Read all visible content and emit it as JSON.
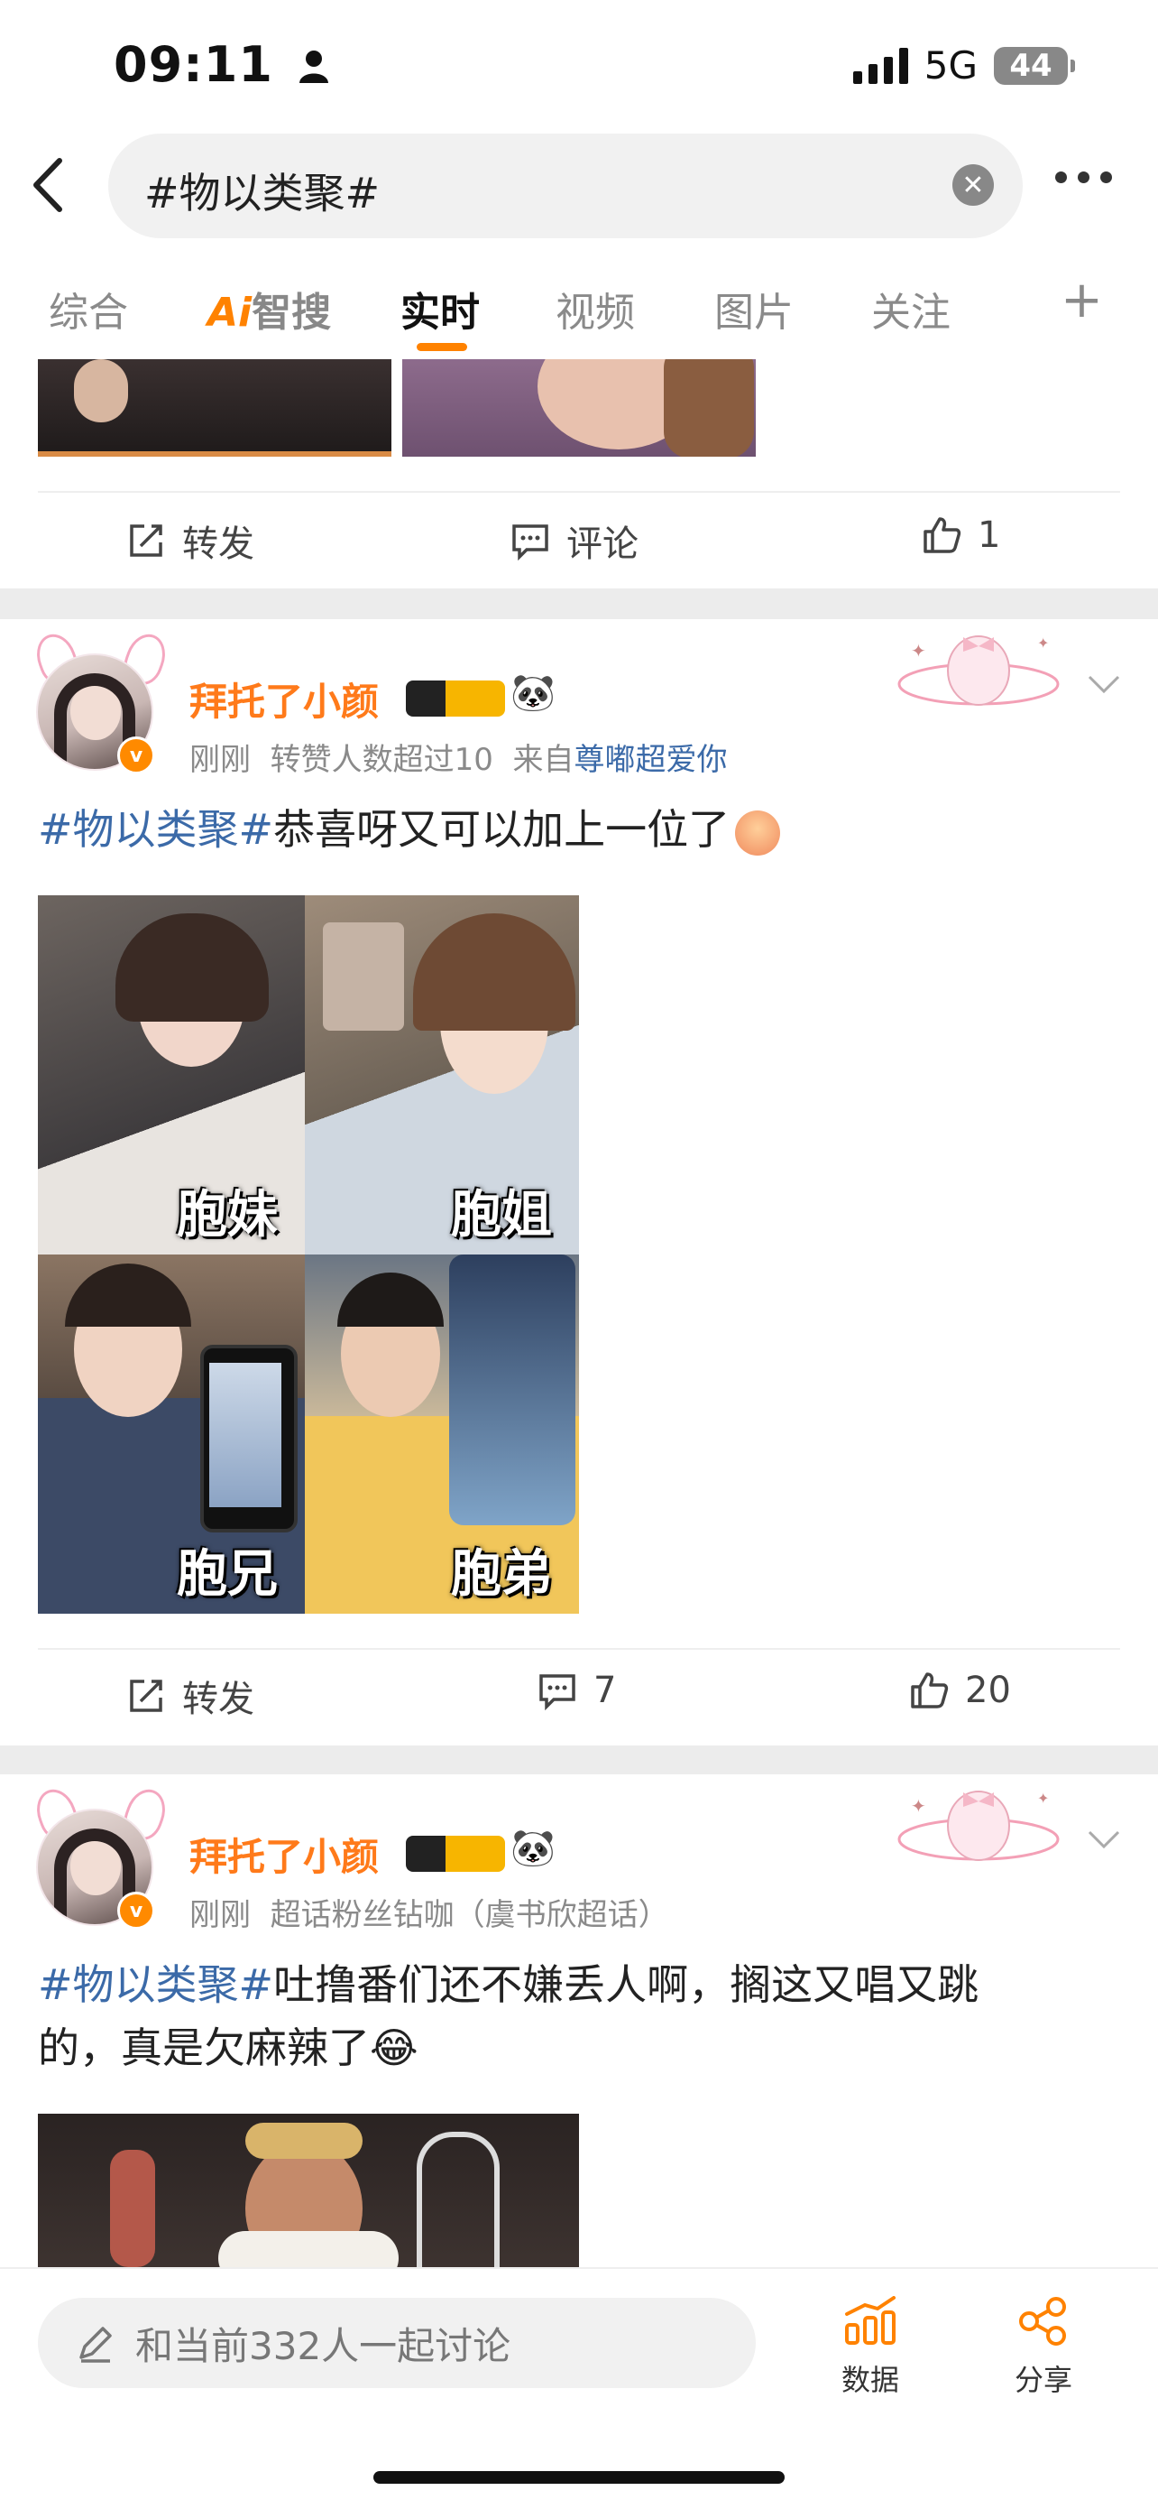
{
  "status_bar": {
    "time": "09:11",
    "network": "5G",
    "battery": "44"
  },
  "search": {
    "query": "#物以类聚#"
  },
  "tabs": [
    {
      "label": "综合"
    },
    {
      "label_ai": "Ai",
      "label_rest": "智搜"
    },
    {
      "label": "实时"
    },
    {
      "label": "视频"
    },
    {
      "label": "图片"
    },
    {
      "label": "关注"
    }
  ],
  "tab_add_symbol": "+",
  "post0": {
    "repost_label": "转发",
    "comment_label": "评论",
    "like_count": "1"
  },
  "post1": {
    "username": "拜托了小颜",
    "meta_time": "刚刚",
    "meta_info": "转赞人数超过10",
    "meta_from_prefix": "来自",
    "meta_from": "尊嘟超爱你",
    "hashtag": "#物以类聚#",
    "text": "恭喜呀又可以加上一位了",
    "images": [
      {
        "label": "胞妹"
      },
      {
        "label": "胞姐"
      },
      {
        "label": "胞兄"
      },
      {
        "label": "胞弟"
      }
    ],
    "repost_label": "转发",
    "comment_count": "7",
    "like_count": "20"
  },
  "post2": {
    "username": "拜托了小颜",
    "meta_time": "刚刚",
    "meta_info": "超话粉丝钻咖（虞书欣超话）",
    "hashtag": "#物以类聚#",
    "text_line1": "吐撸番们还不嫌丢人啊，搁这又唱又跳",
    "text_line2": "的，真是欠麻辣了😂"
  },
  "bottom_bar": {
    "discuss_placeholder": "和当前332人一起讨论",
    "data_label": "数据",
    "share_label": "分享"
  },
  "colors": {
    "accent": "#ff8200",
    "link": "#3b6aa8",
    "username": "#ff7a1a"
  }
}
